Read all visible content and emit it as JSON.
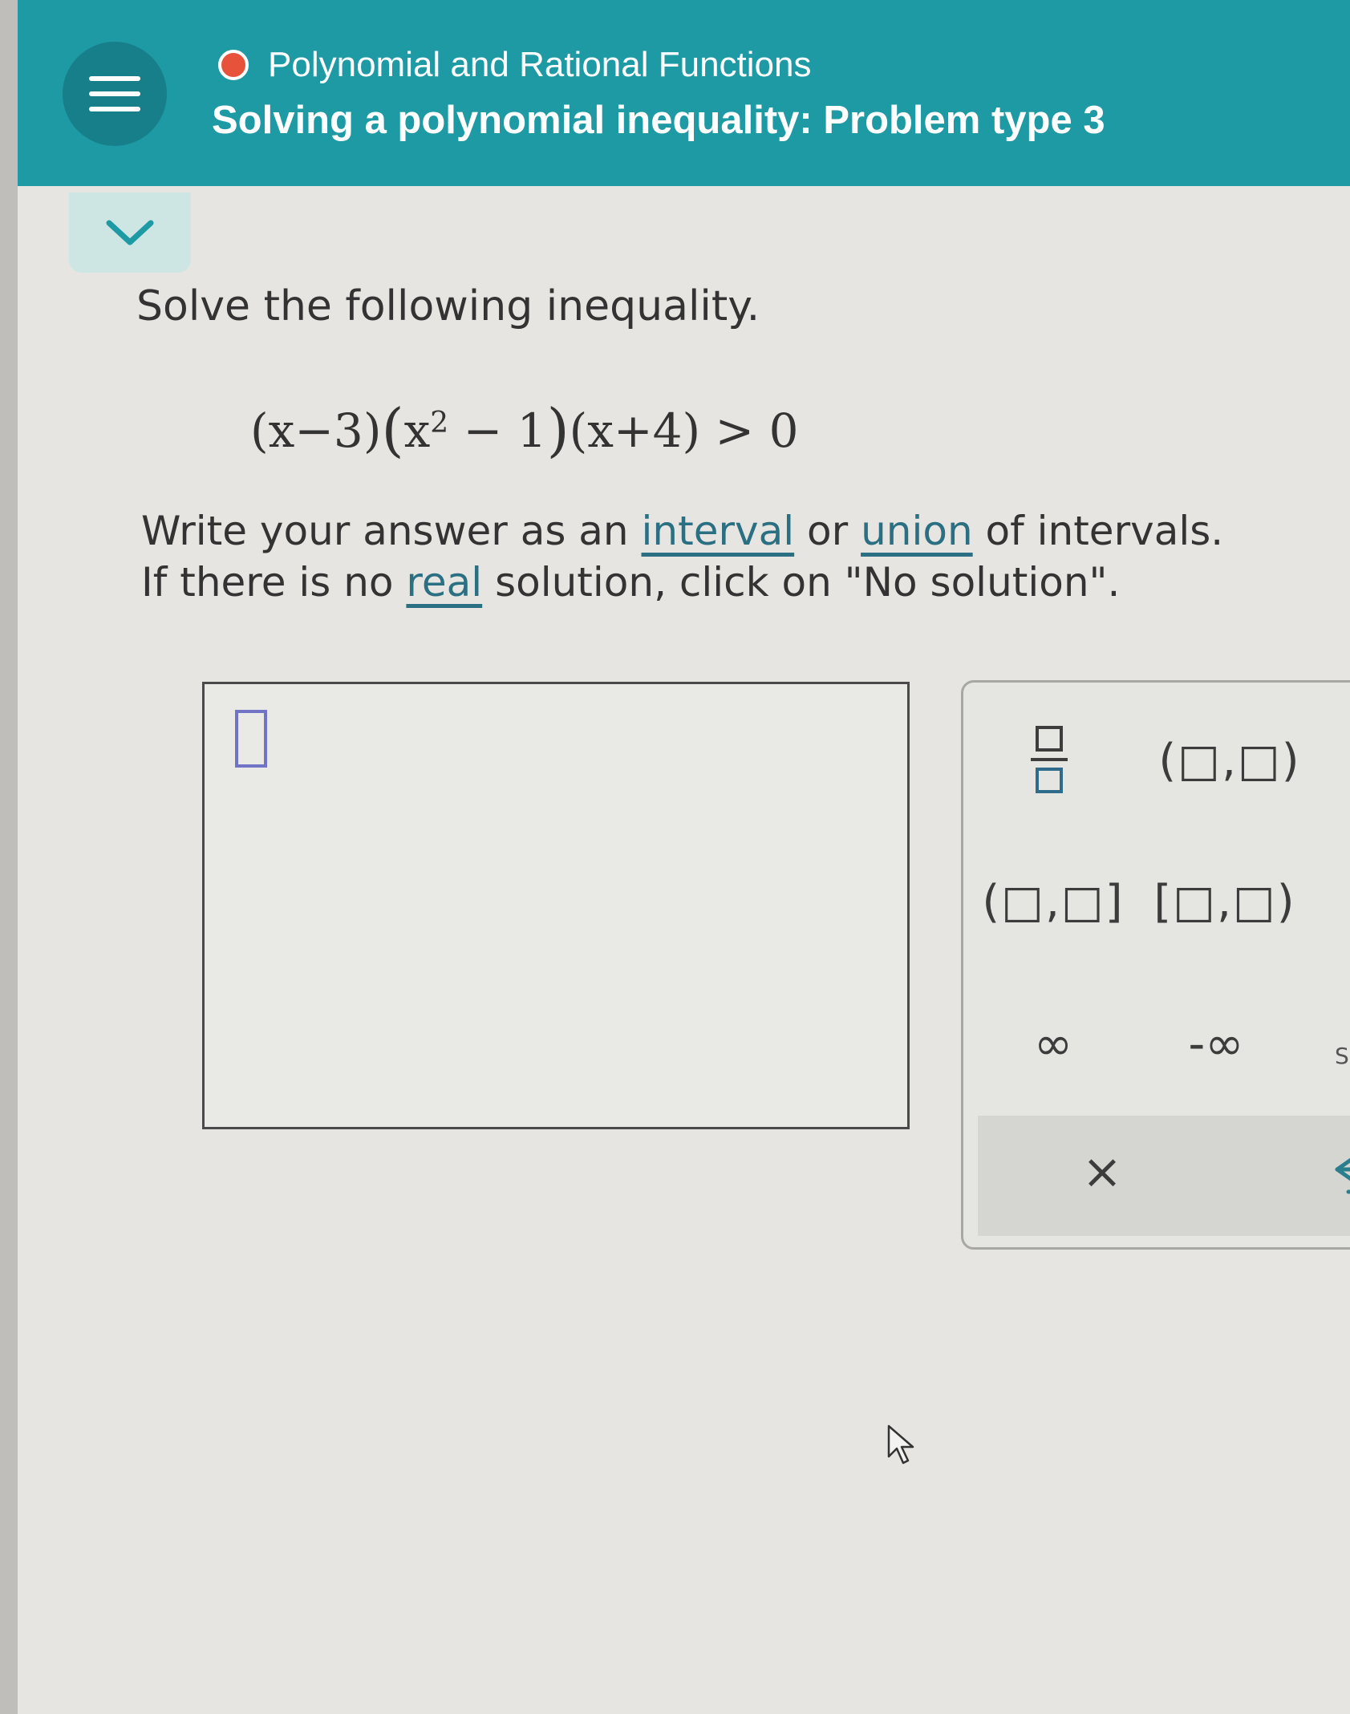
{
  "header": {
    "menu_icon": "hamburger-menu-icon",
    "topic": "Polynomial and Rational Functions",
    "title": "Solving a polynomial inequality: Problem type 3",
    "topic_status_color": "#e6533a",
    "background_color": "#1e9aa5"
  },
  "collapse_toggle": {
    "icon": "chevron-down-icon"
  },
  "problem": {
    "instruction": "Solve the following inequality.",
    "equation": {
      "factor1": "(x−3)",
      "factor2_open": "(",
      "factor2_base": "x",
      "factor2_exponent": "2",
      "factor2_rest": " − 1",
      "factor2_close": ")",
      "factor3": "(x+4)",
      "relation": " > 0"
    },
    "directions_line1_prefix": "Write your answer as an ",
    "directions_link_interval": "interval",
    "directions_line1_mid": " or ",
    "directions_link_union": "union",
    "directions_line1_suffix": " of intervals.",
    "directions_line2_prefix": "If there is no ",
    "directions_link_real": "real",
    "directions_line2_suffix": " solution, click on \"No solution\"."
  },
  "answer": {
    "value": ""
  },
  "keypad": {
    "keys": {
      "open_interval": "(□,□)",
      "half_open_right": "(□,□]",
      "half_open_left": "[□,□)",
      "infinity": "∞",
      "negative_infinity": "-∞",
      "clear": "×",
      "undo_icon": "undo-arrow-icon"
    },
    "side_label_partial": "S"
  }
}
